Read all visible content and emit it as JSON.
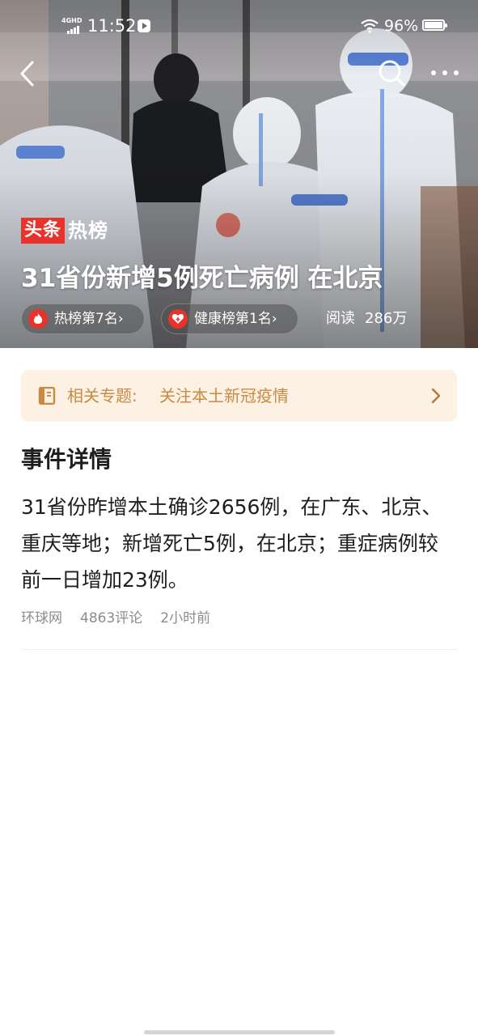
{
  "status_bar": {
    "network": "4GHD",
    "time": "11:52",
    "battery": "96%"
  },
  "header": {
    "brand_box": "头条",
    "brand_text": "热榜",
    "headline": "31省份新增5例死亡病例  在北京",
    "chips": {
      "hot_rank": "热榜第7名",
      "health_rank": "健康榜第1名",
      "chevron": "›"
    },
    "reads_label": "阅读",
    "reads_count": "286万"
  },
  "topic": {
    "label": "相关专题:",
    "title": "关注本土新冠疫情"
  },
  "detail": {
    "section_title": "事件详情",
    "body": "31省份昨增本土确诊2656例，在广东、北京、重庆等地；新增死亡5例，在北京；重症病例较前一日增加23例。",
    "source": "环球网",
    "comments": "4863评论",
    "time_ago": "2小时前"
  },
  "icons": {
    "back": "back-arrow-icon",
    "search": "search-icon",
    "more": "more-dots-icon",
    "fire": "fire-icon",
    "health": "heart-plus-icon",
    "topic": "book-icon",
    "chevron": "chevron-right-icon"
  },
  "colors": {
    "brand_red": "#e8322b",
    "topic_bg": "#fdf1e3",
    "topic_text": "#c98a44",
    "meta_text": "#8c8c8c"
  }
}
